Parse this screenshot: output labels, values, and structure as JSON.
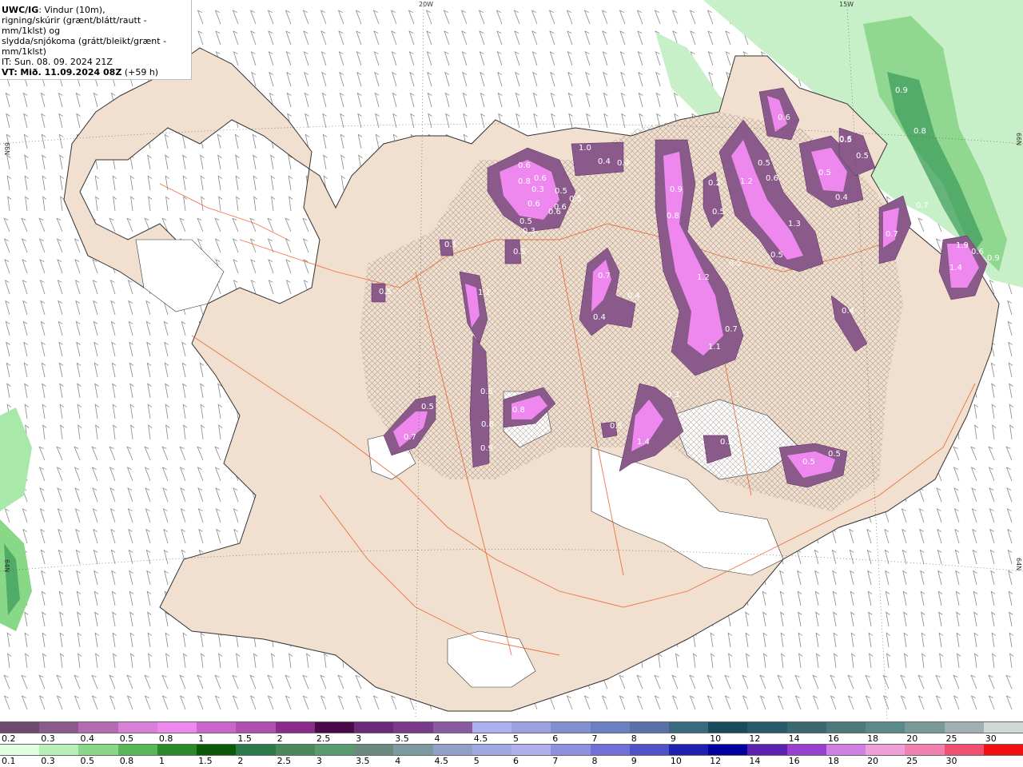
{
  "header": {
    "product": "UWC/IG",
    "line1": ": Vindur (10m),",
    "line2": "rigning/skúrir (grænt/blátt/rautt - mm/1klst) og",
    "line3": "slydda/snjókoma (grátt/bleikt/grænt - mm/1klst)",
    "it": "IT: Sun. 08. 09. 2024 21Z",
    "vt_label": "VT:",
    "vt": "Mið. 11.09.2024 08Z",
    "lead": "(+59 h)"
  },
  "axis_labels": {
    "lon_20w": "20W",
    "lon_15w": "15W",
    "lat_66n_left": "66N",
    "lat_66n_right": "66N",
    "lat_64n_left": "64N",
    "lat_64n_right": "64N"
  },
  "precip_labels": [
    "0.6",
    "0.8",
    "0.6",
    "0.5",
    "0.6",
    "0.6",
    "0.3",
    "0.5",
    "0.5",
    "0.5",
    "1.0",
    "0.4",
    "0.4",
    "0.6",
    "0.9",
    "0.8",
    "0.2",
    "1.2",
    "0.6",
    "0.5",
    "0.5",
    "1.3",
    "0.6",
    "0.5",
    "0.4",
    "0.5",
    "0.7",
    "0.8",
    "0.6",
    "0.5",
    "0.9",
    "0.7",
    "0.6",
    "1.9",
    "1.4",
    "0.9",
    "0.5",
    "0.7",
    "0.4",
    "0.4",
    "1.1",
    "1.2",
    "0.7",
    "1.1",
    "0.4",
    "0.3",
    "0.5",
    "0.5",
    "0.7",
    "0.5",
    "0.8",
    "0.9",
    "0.8",
    "0.5",
    "1.4",
    "0.3",
    "0.5",
    "0.5",
    "0.5",
    "0.5",
    "0.1"
  ],
  "legend_snow": {
    "colors": [
      "#6e4a6e",
      "#8a5a8a",
      "#b36bb3",
      "#d880d8",
      "#ee88ee",
      "#cc66cc",
      "#b050b0",
      "#8a2a8a",
      "#4a0a4a",
      "#6a2a7a",
      "#7a3a8a",
      "#8a5aa0",
      "#aab0f0",
      "#9aa0e0",
      "#8090d0",
      "#6a80c0",
      "#5a70a8",
      "#3a6a80",
      "#1a4a5a",
      "#2a5a6a",
      "#3a6a70",
      "#4a7a7a",
      "#5a8a8a",
      "#7a9a9a",
      "#a0b0b0",
      "#d0d8d8"
    ],
    "labels": [
      "0.2",
      "0.3",
      "0.4",
      "0.5",
      "0.8",
      "1",
      "1.5",
      "2",
      "2.5",
      "3",
      "3.5",
      "4",
      "4.5",
      "5",
      "6",
      "7",
      "8",
      "9",
      "10",
      "12",
      "14",
      "16",
      "18",
      "20",
      "25",
      "30"
    ]
  },
  "legend_rain": {
    "colors": [
      "#dfffdf",
      "#b8eeb8",
      "#88d888",
      "#58b858",
      "#2a8a2a",
      "#0a5a0a",
      "#2a7a4a",
      "#4a8a5a",
      "#5a9a70",
      "#6a8a80",
      "#7a9aa0",
      "#90a0c8",
      "#a0a8e0",
      "#b0b0ee",
      "#9090e0",
      "#7070d8",
      "#5050c8",
      "#2020b0",
      "#0000a0",
      "#5a20b0",
      "#9a40d0",
      "#d080e0",
      "#f0a0d8",
      "#f080b0",
      "#f05070",
      "#f01010"
    ],
    "labels": [
      "0.1",
      "0.3",
      "0.5",
      "0.8",
      "1",
      "1.5",
      "2",
      "2.5",
      "3",
      "3.5",
      "4",
      "4.5",
      "5",
      "6",
      "7",
      "8",
      "9",
      "10",
      "12",
      "14",
      "16",
      "18",
      "20",
      "25",
      "30"
    ]
  },
  "colors": {
    "land": "#f1dfcf",
    "road": "#e8602a",
    "snow_light": "#8a5a8a",
    "snow_core": "#ee88ee",
    "rain": "#a8e8a8",
    "rain_dark": "#3a9a5a",
    "glacier": "#ffffff"
  }
}
